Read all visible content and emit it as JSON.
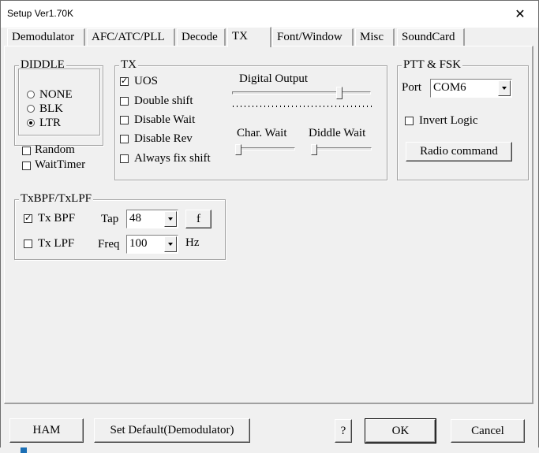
{
  "window": {
    "title": "Setup Ver1.70K",
    "close_glyph": "✕"
  },
  "tabs": [
    {
      "label": "Demodulator"
    },
    {
      "label": "AFC/ATC/PLL"
    },
    {
      "label": "Decode"
    },
    {
      "label": "TX",
      "active": true
    },
    {
      "label": "Font/Window"
    },
    {
      "label": "Misc"
    },
    {
      "label": "SoundCard"
    }
  ],
  "diddle": {
    "title": "DIDDLE",
    "options": [
      {
        "label": "NONE",
        "selected": false
      },
      {
        "label": "BLK",
        "selected": false
      },
      {
        "label": "LTR",
        "selected": true
      }
    ],
    "random": {
      "label": "Random",
      "checked": false
    },
    "waittimer": {
      "label": "WaitTimer",
      "checked": false
    }
  },
  "tx": {
    "title": "TX",
    "uos": {
      "label": "UOS",
      "checked": true
    },
    "double_shift": {
      "label": "Double shift",
      "checked": false
    },
    "disable_wait": {
      "label": "Disable Wait",
      "checked": false
    },
    "disable_rev": {
      "label": "Disable Rev",
      "checked": false
    },
    "always_fix_shift": {
      "label": "Always fix shift",
      "checked": false
    },
    "digital_output_label": "Digital Output",
    "char_wait_label": "Char. Wait",
    "diddle_wait_label": "Diddle Wait"
  },
  "ptt": {
    "title": "PTT & FSK",
    "port_label": "Port",
    "port_value": "COM6",
    "invert_logic": {
      "label": "Invert Logic",
      "checked": false
    },
    "radio_command_label": "Radio command"
  },
  "bpf": {
    "title": "TxBPF/TxLPF",
    "tx_bpf": {
      "label": "Tx BPF",
      "checked": true
    },
    "tap_label": "Tap",
    "tap_value": "48",
    "f_button": "f",
    "tx_lpf": {
      "label": "Tx LPF",
      "checked": false
    },
    "freq_label": "Freq",
    "freq_value": "100",
    "hz_label": "Hz"
  },
  "footer": {
    "ham_label": "HAM",
    "set_default_label": "Set Default(Demodulator)",
    "help_label": "?",
    "ok_label": "OK",
    "cancel_label": "Cancel"
  },
  "check_glyph": "✓"
}
